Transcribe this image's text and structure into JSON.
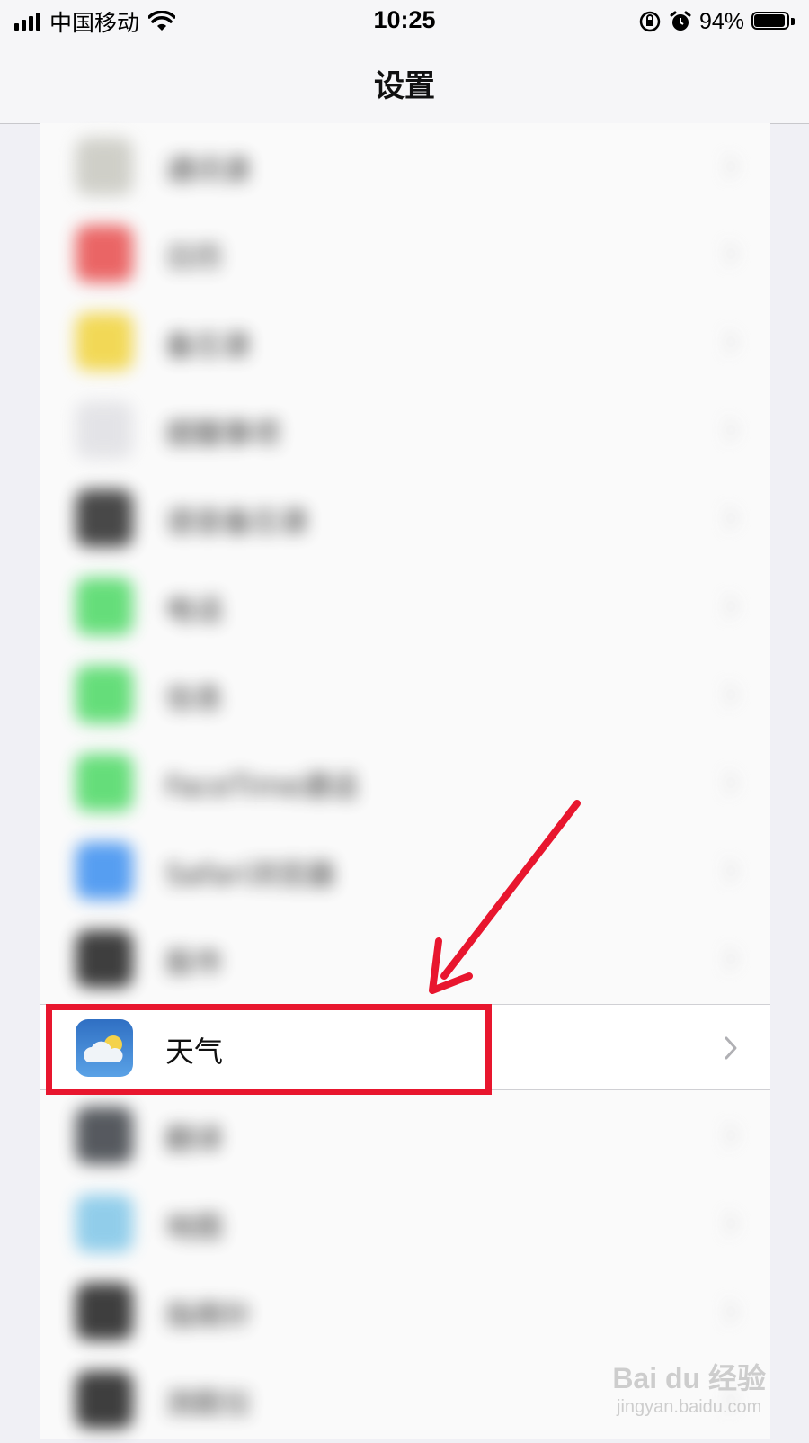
{
  "status_bar": {
    "carrier": "中国移动",
    "time": "10:25",
    "battery_percent": "94%",
    "battery_level": 0.94,
    "icons": [
      "signal-icon",
      "wifi-icon",
      "orientation-lock-icon",
      "alarm-icon",
      "battery-icon"
    ]
  },
  "nav": {
    "title": "设置"
  },
  "settings_list": {
    "focused_item": {
      "label": "天气",
      "icon": "weather-icon"
    },
    "blurred_items": [
      {
        "label": "通讯录",
        "icon_color": "#c8c8c0"
      },
      {
        "label": "日历",
        "icon_color": "#e84c4c"
      },
      {
        "label": "备忘录",
        "icon_color": "#f1d33a"
      },
      {
        "label": "提醒事项",
        "icon_color": "#e0e0e4"
      },
      {
        "label": "语音备忘录",
        "icon_color": "#2a2a2a"
      },
      {
        "label": "电话",
        "icon_color": "#4cd964"
      },
      {
        "label": "信息",
        "icon_color": "#4cd964"
      },
      {
        "label": "FaceTime通话",
        "icon_color": "#4cd964"
      },
      {
        "label": "Safari浏览器",
        "icon_color": "#3a8ef0"
      },
      {
        "label": "股市",
        "icon_color": "#1e1e1e"
      },
      {
        "label": "翻译",
        "icon_color": "#3a3e44"
      },
      {
        "label": "地图",
        "icon_color": "#7fc6e8"
      },
      {
        "label": "指南针",
        "icon_color": "#1e1e1e"
      },
      {
        "label": "测距仪",
        "icon_color": "#1e1e1e"
      }
    ]
  },
  "annotation": {
    "highlight_color": "#e8162e"
  },
  "watermark": {
    "main": "Bai du 经验",
    "sub": "jingyan.baidu.com"
  }
}
